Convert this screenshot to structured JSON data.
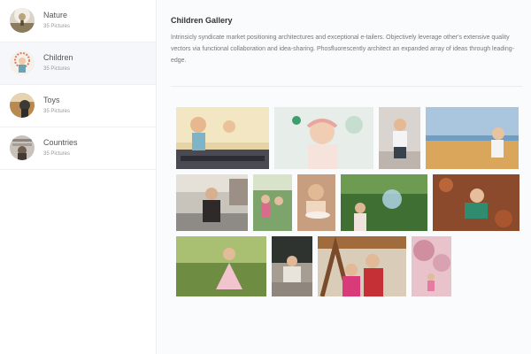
{
  "albums": [
    {
      "name": "Nature",
      "count": "35 Pictures",
      "icon": "nature-avatar-icon"
    },
    {
      "name": "Children",
      "count": "35 Pictures",
      "icon": "children-avatar-icon"
    },
    {
      "name": "Toys",
      "count": "35 Pictures",
      "icon": "toys-avatar-icon"
    },
    {
      "name": "Countries",
      "count": "35 Pictures",
      "icon": "countries-avatar-icon"
    }
  ],
  "active_album": "Children",
  "gallery": {
    "title": "Children Gallery",
    "description": "Intrinsicly syndicate market positioning architectures and exceptional e-tailers. Objectively leverage other's extensive quality vectors via functional collaboration and idea-sharing. Phosfluorescently architect an expanded array of ideas through leading-edge."
  }
}
